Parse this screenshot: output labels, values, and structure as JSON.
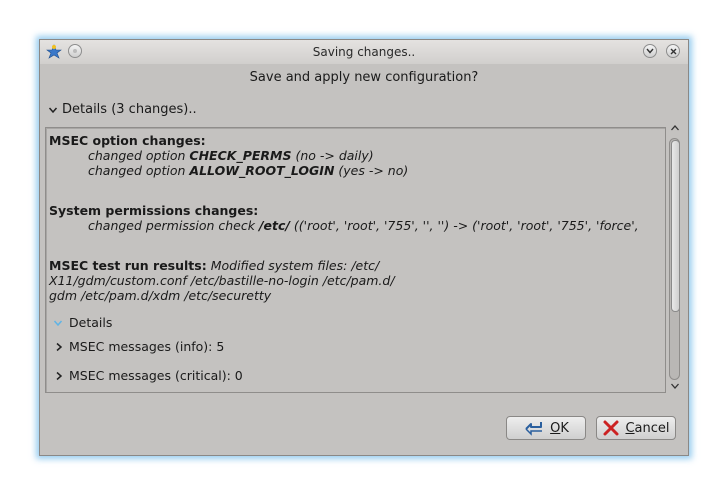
{
  "window": {
    "title": "Saving changes..",
    "question": "Save and apply new configuration?"
  },
  "details_toggle": {
    "label": "Details (3 changes).."
  },
  "sections": {
    "msec_options": {
      "heading": "MSEC option changes:",
      "line1_prefix": "changed option ",
      "line1_option": "CHECK_PERMS",
      "line1_suffix": " (no -> daily)",
      "line2_prefix": "changed option ",
      "line2_option": "ALLOW_ROOT_LOGIN",
      "line2_suffix": " (yes -> no)"
    },
    "permissions": {
      "heading": "System permissions changes:",
      "line_prefix": "changed permission check ",
      "line_path": "/etc/",
      "line_suffix": " (('root', 'root', '755', '', '') -> ('root', 'root', '755', 'force',"
    },
    "test_run": {
      "heading": "MSEC test run results:",
      "line1": " Modified system files: /etc/",
      "line2": "X11/gdm/custom.conf /etc/bastille-no-login /etc/pam.d/",
      "line3": "gdm /etc/pam.d/xdm /etc/securetty"
    }
  },
  "tree": {
    "root_label": "Details",
    "items": [
      {
        "label": "MSEC messages (info): 5"
      },
      {
        "label": "MSEC messages (critical): 0"
      }
    ]
  },
  "buttons": {
    "ok": {
      "mnemonic": "O",
      "rest": "K"
    },
    "cancel": {
      "mnemonic": "C",
      "rest": "ancel"
    }
  },
  "icons": {
    "app": "mandriva-star-icon",
    "menu": "window-menu-icon",
    "minimize": "chevron-down-icon",
    "close": "close-icon",
    "ok": "checkmark-arrow-icon",
    "cancel": "red-x-icon"
  },
  "colors": {
    "accent": "#5fb4e6",
    "window_bg": "#c4c2c0",
    "cancel_red": "#cc2222"
  }
}
